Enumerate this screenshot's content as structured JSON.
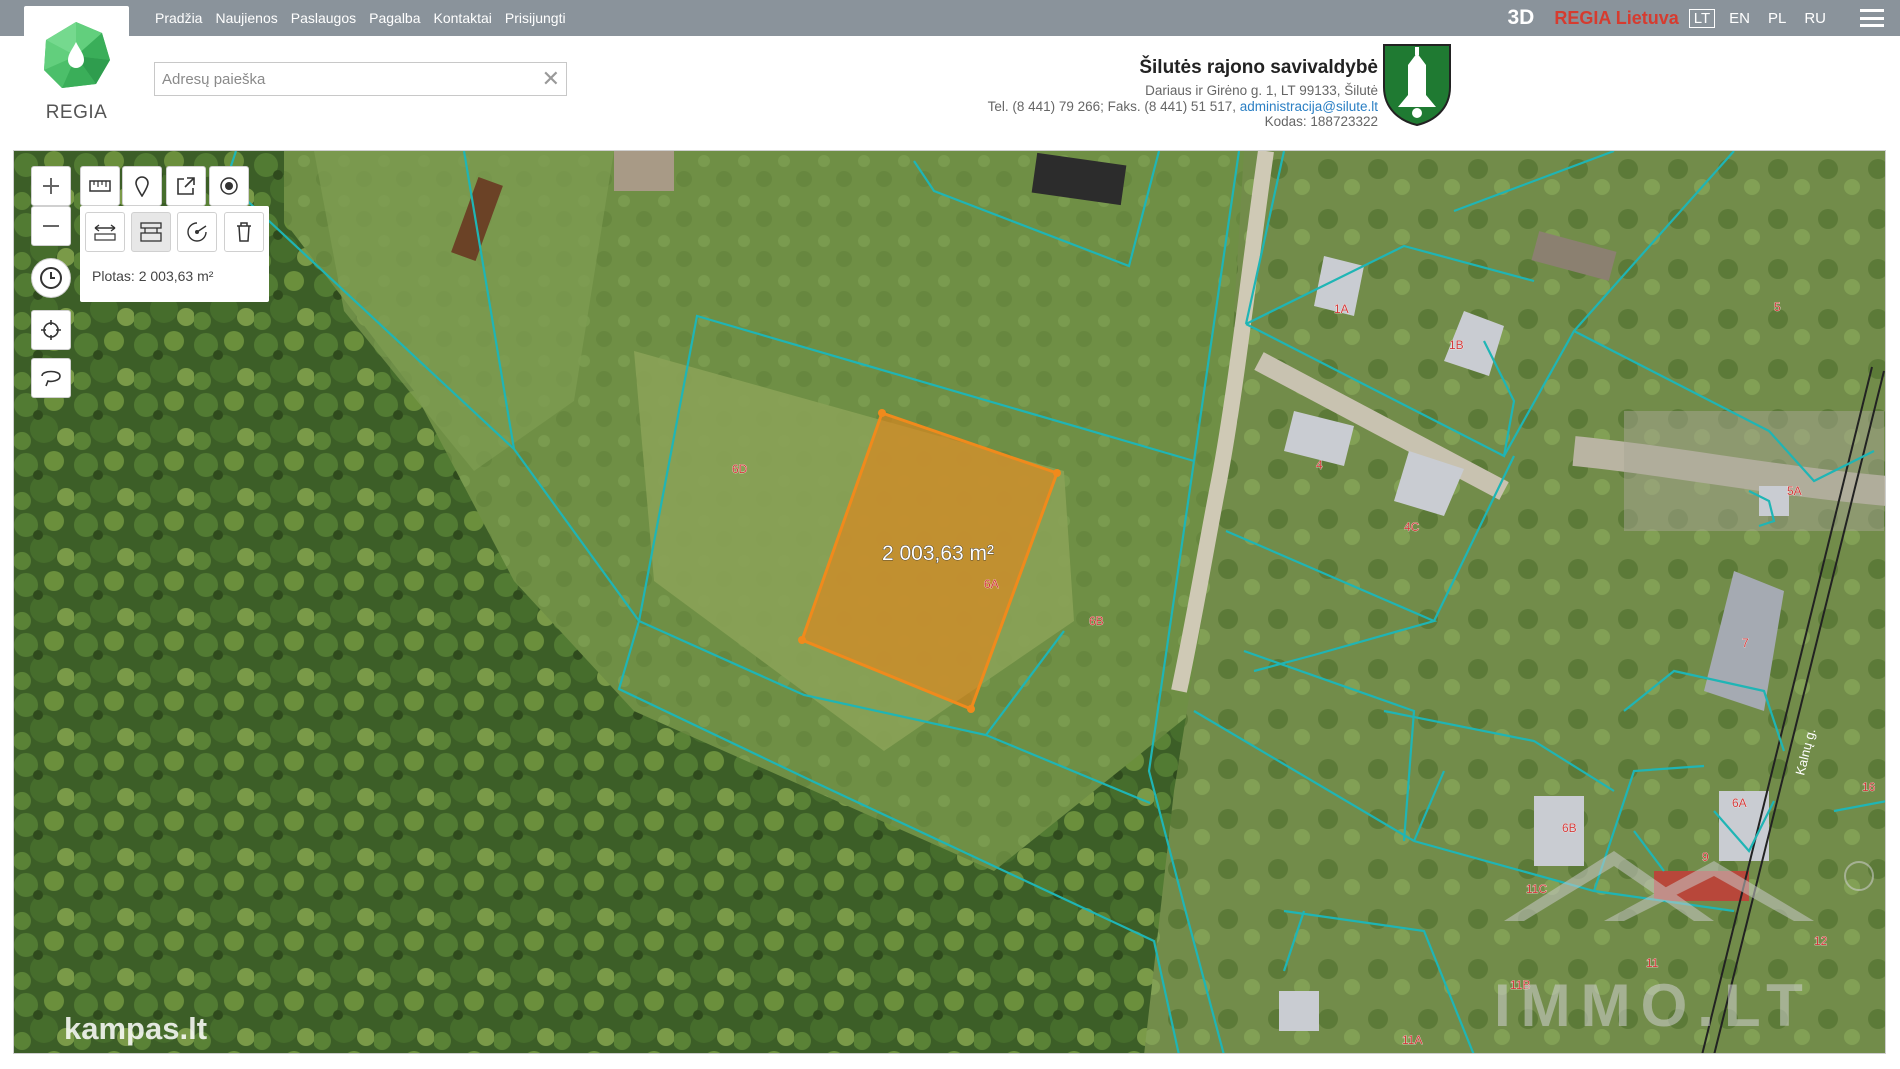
{
  "nav": [
    "Pradžia",
    "Naujienos",
    "Paslaugos",
    "Pagalba",
    "Kontaktai",
    "Prisijungti"
  ],
  "top_right": {
    "btn_3d": "3D",
    "regia_link": "REGIA Lietuva",
    "languages": [
      {
        "code": "LT",
        "active": true
      },
      {
        "code": "EN",
        "active": false
      },
      {
        "code": "PL",
        "active": false
      },
      {
        "code": "RU",
        "active": false
      }
    ]
  },
  "logo": {
    "text": "REGIA"
  },
  "search": {
    "placeholder": "Adresų paieška",
    "value": "",
    "clear": "✕"
  },
  "municipality": {
    "name": "Šilutės rajono savivaldybė",
    "address": "Dariaus ir Girėno g. 1, LT 99133, Šilutė",
    "phones": "Tel. (8 441) 79 266; Faks. (8 441) 51 517,",
    "email": "administracija@silute.lt",
    "code": "Kodas: 188723322"
  },
  "measure": {
    "area_panel_text": "Plotas: 2 003,63 m²",
    "area_map_label": "2 003,63 m²"
  },
  "parcel_labels": [
    "6D",
    "6A",
    "6B",
    "1A",
    "1B",
    "4",
    "4C",
    "5",
    "5A",
    "7",
    "6B",
    "11C",
    "11",
    "11B",
    "11A",
    "12",
    "16",
    "6A",
    "9"
  ],
  "street_label": "Kalnų g.",
  "watermarks": {
    "left": "kampas.lt",
    "right": "IMMO.LT"
  },
  "colors": {
    "accent_orange": "#f08a1c",
    "parcel_line": "#1fb5b5",
    "topbar": "#8a939b",
    "regia_red": "#d63b2f"
  }
}
